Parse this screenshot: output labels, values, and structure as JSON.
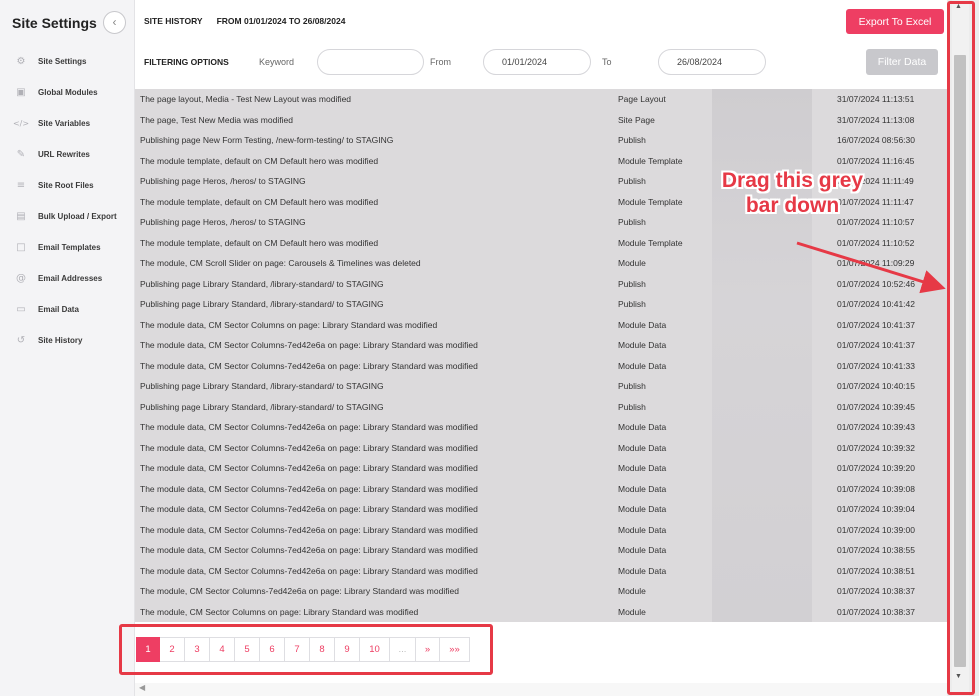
{
  "sidebar": {
    "title": "Site Settings",
    "collapse_icon": "chevron-left",
    "items": [
      {
        "label": "Site Settings",
        "icon": "gear"
      },
      {
        "label": "Global Modules",
        "icon": "cube"
      },
      {
        "label": "Site Variables",
        "icon": "code"
      },
      {
        "label": "URL Rewrites",
        "icon": "pen"
      },
      {
        "label": "Site Root Files",
        "icon": "layers"
      },
      {
        "label": "Bulk Upload / Export",
        "icon": "file"
      },
      {
        "label": "Email Templates",
        "icon": "envelope-template"
      },
      {
        "label": "Email Addresses",
        "icon": "at"
      },
      {
        "label": "Email Data",
        "icon": "inbox"
      },
      {
        "label": "Site History",
        "icon": "history"
      }
    ]
  },
  "header": {
    "title": "SITE HISTORY",
    "range": "FROM 01/01/2024 TO 26/08/2024",
    "export_label": "Export To Excel"
  },
  "filters": {
    "title": "FILTERING OPTIONS",
    "keyword_label": "Keyword",
    "keyword_value": "",
    "from_label": "From",
    "from_value": "01/01/2024",
    "to_label": "To",
    "to_value": "26/08/2024",
    "filter_label": "Filter Data"
  },
  "table": {
    "rows": [
      [
        "The page layout, Media - Test New Layout was modified",
        "Page Layout",
        "31/07/2024 11:13:51"
      ],
      [
        "The page, Test New Media was modified",
        "Site Page",
        "31/07/2024 11:13:08"
      ],
      [
        "Publishing page New Form Testing, /new-form-testing/ to STAGING",
        "Publish",
        "16/07/2024 08:56:30"
      ],
      [
        "The module template, default on CM Default hero was modified",
        "Module Template",
        "01/07/2024 11:16:45"
      ],
      [
        "Publishing page Heros, /heros/ to STAGING",
        "Publish",
        "01/07/2024 11:11:49"
      ],
      [
        "The module template, default on CM Default hero was modified",
        "Module Template",
        "01/07/2024 11:11:47"
      ],
      [
        "Publishing page Heros, /heros/ to STAGING",
        "Publish",
        "01/07/2024 11:10:57"
      ],
      [
        "The module template, default on CM Default hero was modified",
        "Module Template",
        "01/07/2024 11:10:52"
      ],
      [
        "The module, CM Scroll Slider on page: Carousels & Timelines was deleted",
        "Module",
        "01/07/2024 11:09:29"
      ],
      [
        "Publishing page Library Standard, /library-standard/ to STAGING",
        "Publish",
        "01/07/2024 10:52:46"
      ],
      [
        "Publishing page Library Standard, /library-standard/ to STAGING",
        "Publish",
        "01/07/2024 10:41:42"
      ],
      [
        "The module data, CM Sector Columns on page: Library Standard was modified",
        "Module Data",
        "01/07/2024 10:41:37"
      ],
      [
        "The module data, CM Sector Columns-7ed42e6a on page: Library Standard was modified",
        "Module Data",
        "01/07/2024 10:41:37"
      ],
      [
        "The module data, CM Sector Columns-7ed42e6a on page: Library Standard was modified",
        "Module Data",
        "01/07/2024 10:41:33"
      ],
      [
        "Publishing page Library Standard, /library-standard/ to STAGING",
        "Publish",
        "01/07/2024 10:40:15"
      ],
      [
        "Publishing page Library Standard, /library-standard/ to STAGING",
        "Publish",
        "01/07/2024 10:39:45"
      ],
      [
        "The module data, CM Sector Columns-7ed42e6a on page: Library Standard was modified",
        "Module Data",
        "01/07/2024 10:39:43"
      ],
      [
        "The module data, CM Sector Columns-7ed42e6a on page: Library Standard was modified",
        "Module Data",
        "01/07/2024 10:39:32"
      ],
      [
        "The module data, CM Sector Columns-7ed42e6a on page: Library Standard was modified",
        "Module Data",
        "01/07/2024 10:39:20"
      ],
      [
        "The module data, CM Sector Columns-7ed42e6a on page: Library Standard was modified",
        "Module Data",
        "01/07/2024 10:39:08"
      ],
      [
        "The module data, CM Sector Columns-7ed42e6a on page: Library Standard was modified",
        "Module Data",
        "01/07/2024 10:39:04"
      ],
      [
        "The module data, CM Sector Columns-7ed42e6a on page: Library Standard was modified",
        "Module Data",
        "01/07/2024 10:39:00"
      ],
      [
        "The module data, CM Sector Columns-7ed42e6a on page: Library Standard was modified",
        "Module Data",
        "01/07/2024 10:38:55"
      ],
      [
        "The module data, CM Sector Columns-7ed42e6a on page: Library Standard was modified",
        "Module Data",
        "01/07/2024 10:38:51"
      ],
      [
        "The module, CM Sector Columns-7ed42e6a on page: Library Standard was modified",
        "Module",
        "01/07/2024 10:38:37"
      ],
      [
        "The module, CM Sector Columns on page: Library Standard was modified",
        "Module",
        "01/07/2024 10:38:37"
      ]
    ]
  },
  "pagination": {
    "pages": [
      "1",
      "2",
      "3",
      "4",
      "5",
      "6",
      "7",
      "8",
      "9",
      "10",
      "...",
      "»",
      "»»"
    ],
    "active": "1"
  },
  "annotation": {
    "text_line1": "Drag this grey",
    "text_line2": "bar down",
    "color": "#e63946"
  },
  "colors": {
    "accent": "#ee3e63",
    "table_bg": "#dcdadc",
    "scroll_thumb": "#c1c1c1"
  }
}
